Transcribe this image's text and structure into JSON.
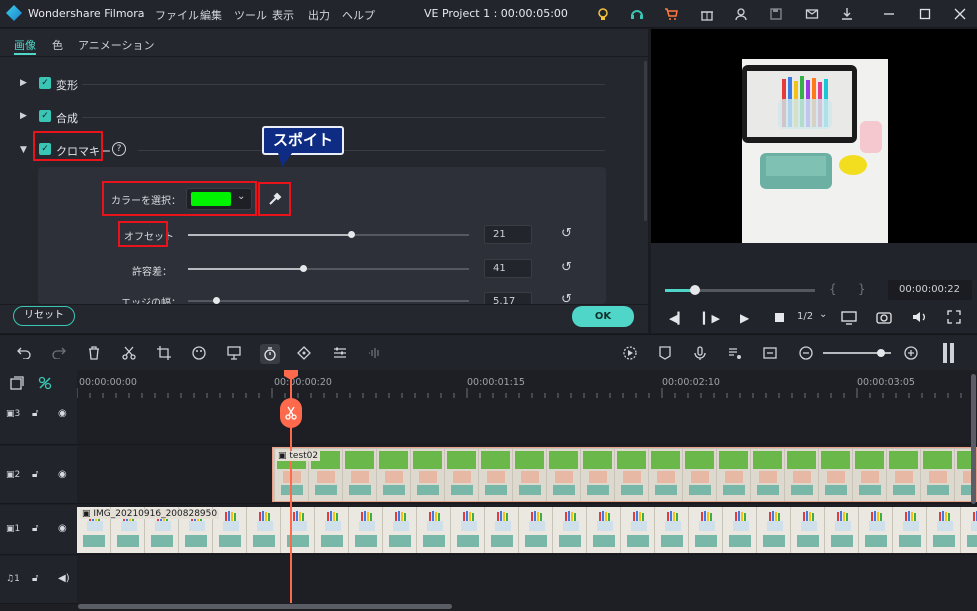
{
  "app": {
    "title": "Wondershare Filmora",
    "project_title": "VE Project 1 : 00:00:05:00"
  },
  "menu": [
    "ファイル",
    "編集",
    "ツール",
    "表示",
    "出力",
    "ヘルプ"
  ],
  "panel": {
    "tabs": [
      "画像",
      "色",
      "アニメーション"
    ],
    "sections": {
      "transform": "変形",
      "composite": "合成",
      "chroma": "クロマキー"
    },
    "chroma": {
      "color_label": "カラーを選択：",
      "color_value": "#00f300",
      "offset_label": "オフセット",
      "offset_value": "21",
      "offset_level": 0.58,
      "tolerance_label": "許容差：",
      "tolerance_value": "41",
      "tolerance_level": 0.41,
      "edge_label": "エッジの幅：",
      "edge_value": "5.17",
      "edge_level": 0.1
    },
    "callout": "スポイト",
    "reset_button": "リセット",
    "ok_button": "OK"
  },
  "player": {
    "timecode": "00:00:00:22",
    "bracket_in": "{",
    "bracket_out": "}",
    "quality": "1/2",
    "progress": 0.2
  },
  "timeline": {
    "timecodes": [
      "00:00:00:00",
      "00:00:00:20",
      "00:00:01:15",
      "00:00:02:10",
      "00:00:03:05"
    ],
    "tracks": [
      {
        "id": "3",
        "kind": "video"
      },
      {
        "id": "2",
        "kind": "video",
        "clip": "test02"
      },
      {
        "id": "1",
        "kind": "video",
        "clip": "IMG_20210916_200828950"
      },
      {
        "id": "1",
        "kind": "audio"
      }
    ]
  },
  "colors": {
    "accent": "#4fd6c8",
    "highlight": "#e8131b",
    "playhead": "#ff6a4d",
    "callout": "#0f2c84"
  }
}
